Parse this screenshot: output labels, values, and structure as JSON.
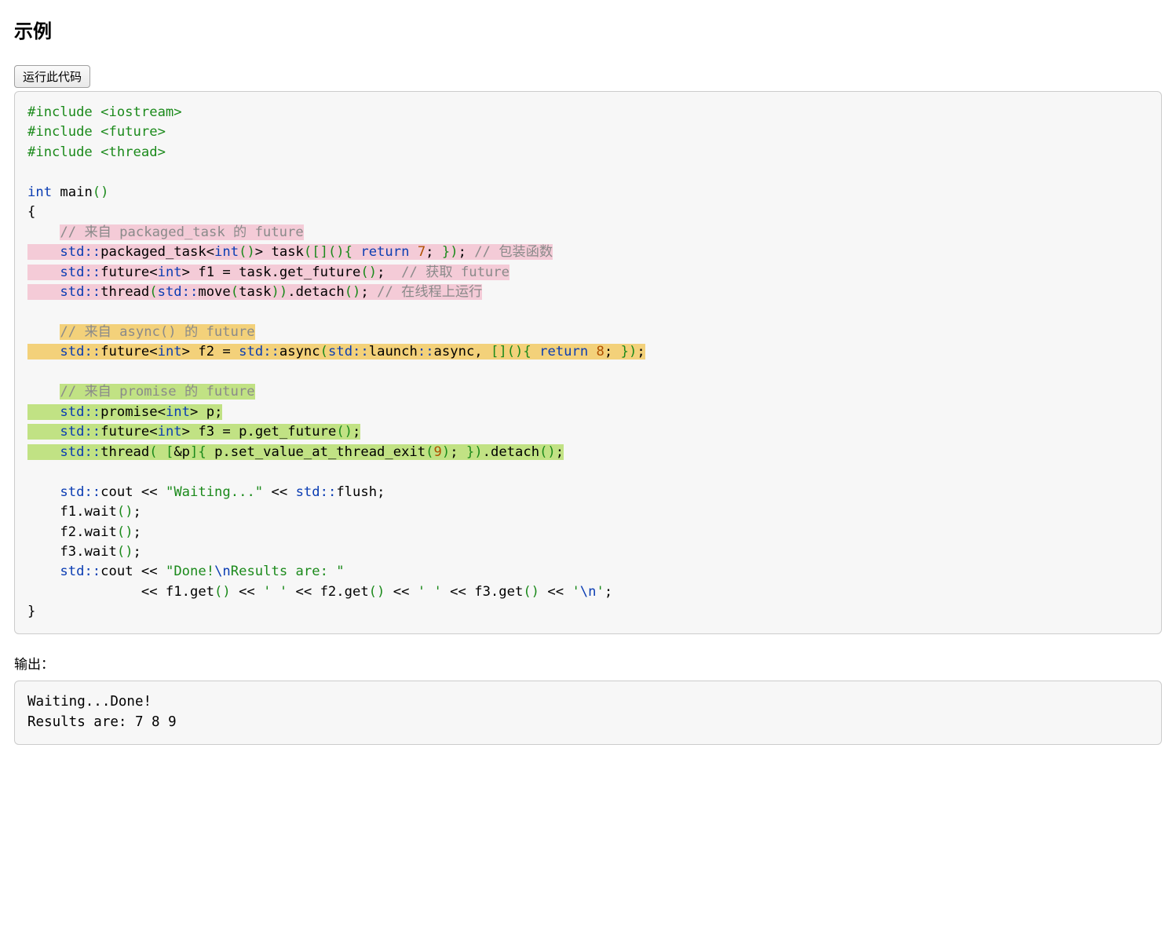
{
  "heading": "示例",
  "run_button": "运行此代码",
  "code": {
    "inc1": "#include <iostream>",
    "inc2": "#include <future>",
    "inc3": "#include <thread>",
    "kw_int": "int",
    "main": " main",
    "lp": "(",
    "rp": ")",
    "lbrace": "{",
    "indent": "    ",
    "cmt_pack": "// 来自 packaged_task 的 future",
    "l_pt1_a": "std",
    "l_pt1_b": "::",
    "l_pt1_c": "packaged_task",
    "l_pt1_d": "<",
    "l_pt1_e": "int",
    "l_pt1_f": "()",
    "l_pt1_g": ">",
    "l_pt1_h": " task",
    "l_pt1_i": "(",
    "l_pt1_j": "[](){",
    "l_pt1_k": " return ",
    "l_pt1_l": "7",
    "l_pt1_m": ";",
    "l_pt1_n": " }",
    "l_pt1_o": ")",
    "l_pt1_p": ";",
    "l_pt1_cmt": " // 包装函数",
    "l_pt2_a": "std",
    "l_pt2_b": "::",
    "l_pt2_c": "future",
    "l_pt2_d": "<",
    "l_pt2_e": "int",
    "l_pt2_f": ">",
    "l_pt2_g": " f1 ",
    "l_pt2_h": "=",
    "l_pt2_i": " task.get_future",
    "l_pt2_j": "()",
    "l_pt2_k": ";",
    "l_pt2_cmt": "  // 获取 future",
    "l_pt3_a": "std",
    "l_pt3_b": "::",
    "l_pt3_c": "thread",
    "l_pt3_d": "(",
    "l_pt3_e": "std",
    "l_pt3_f": "::",
    "l_pt3_g": "move",
    "l_pt3_h": "(",
    "l_pt3_i": "task",
    "l_pt3_j": ")",
    "l_pt3_k": ")",
    "l_pt3_l": ".detach",
    "l_pt3_m": "()",
    "l_pt3_n": ";",
    "l_pt3_cmt": " // 在线程上运行",
    "cmt_async": "// 来自 async() 的 future",
    "l_as_a": "std",
    "l_as_b": "::",
    "l_as_c": "future",
    "l_as_d": "<",
    "l_as_e": "int",
    "l_as_f": ">",
    "l_as_g": " f2 ",
    "l_as_h": "=",
    "l_as_i": " std",
    "l_as_j": "::",
    "l_as_k": "async",
    "l_as_l": "(",
    "l_as_m": "std",
    "l_as_n": "::",
    "l_as_o": "launch",
    "l_as_p": "::",
    "l_as_q": "async",
    "l_as_r": ", ",
    "l_as_s": "[](){",
    "l_as_t": " return ",
    "l_as_u": "8",
    "l_as_v": ";",
    "l_as_w": " }",
    "l_as_x": ")",
    "l_as_y": ";",
    "cmt_prom": "// 来自 promise 的 future",
    "l_pr1_a": "std",
    "l_pr1_b": "::",
    "l_pr1_c": "promise",
    "l_pr1_d": "<",
    "l_pr1_e": "int",
    "l_pr1_f": ">",
    "l_pr1_g": " p",
    "l_pr1_h": ";",
    "l_pr2_a": "std",
    "l_pr2_b": "::",
    "l_pr2_c": "future",
    "l_pr2_d": "<",
    "l_pr2_e": "int",
    "l_pr2_f": ">",
    "l_pr2_g": " f3 ",
    "l_pr2_h": "=",
    "l_pr2_i": " p.get_future",
    "l_pr2_j": "()",
    "l_pr2_k": ";",
    "l_pr3_a": "std",
    "l_pr3_b": "::",
    "l_pr3_c": "thread",
    "l_pr3_d": "(",
    "l_pr3_e": " [",
    "l_pr3_f": "&",
    "l_pr3_g": "p",
    "l_pr3_h": "]{",
    "l_pr3_i": " p.set_value_at_thread_exit",
    "l_pr3_j": "(",
    "l_pr3_k": "9",
    "l_pr3_l": ")",
    "l_pr3_m": ";",
    "l_pr3_n": " }",
    "l_pr3_o": ")",
    "l_pr3_p": ".detach",
    "l_pr3_q": "()",
    "l_pr3_r": ";",
    "l_co1_a": "std",
    "l_co1_b": "::",
    "l_co1_c": "cout",
    "l_co1_d": " << ",
    "l_co1_e": "\"Waiting...\"",
    "l_co1_f": " << ",
    "l_co1_g": "std",
    "l_co1_h": "::",
    "l_co1_i": "flush",
    "l_co1_j": ";",
    "l_w1": "f1.wait",
    "l_w1p": "()",
    "l_w1s": ";",
    "l_w2": "f2.wait",
    "l_w2p": "()",
    "l_w2s": ";",
    "l_w3": "f3.wait",
    "l_w3p": "()",
    "l_w3s": ";",
    "l_co2_a": "std",
    "l_co2_b": "::",
    "l_co2_c": "cout",
    "l_co2_d": " << ",
    "l_co2_e": "\"Done!",
    "l_co2_f": "\\n",
    "l_co2_g": "Results are: \"",
    "l_co3_pad": "              ",
    "l_co3_a": "<< ",
    "l_co3_b": "f1.get",
    "l_co3_c": "()",
    "l_co3_d": " << ",
    "l_co3_e": "' '",
    "l_co3_f": " << ",
    "l_co3_g": "f2.get",
    "l_co3_h": "()",
    "l_co3_i": " << ",
    "l_co3_j": "' '",
    "l_co3_k": " << ",
    "l_co3_l": "f3.get",
    "l_co3_m": "()",
    "l_co3_n": " << ",
    "l_co3_o": "'",
    "l_co3_p": "\\n",
    "l_co3_q": "'",
    "l_co3_r": ";",
    "rbrace": "}"
  },
  "output_label": "输出：",
  "output_text": "Waiting...Done!\nResults are: 7 8 9"
}
